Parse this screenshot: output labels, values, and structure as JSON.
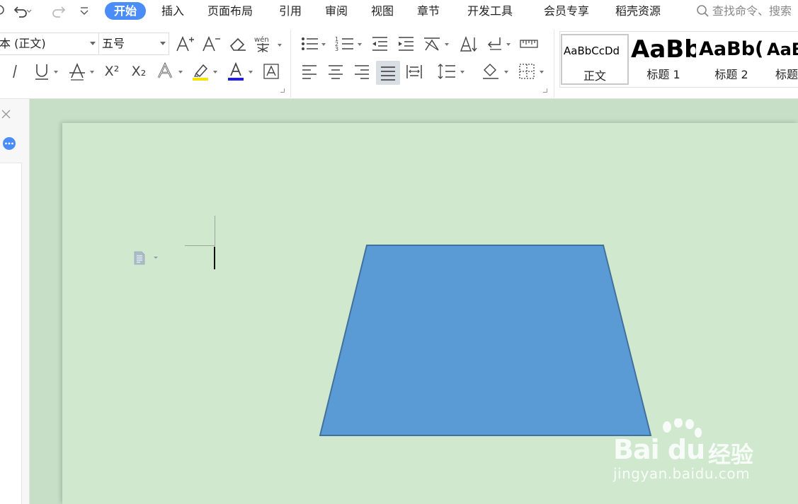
{
  "menubar": {
    "tabs": [
      {
        "label": "开始",
        "active": true
      },
      {
        "label": "插入"
      },
      {
        "label": "页面布局"
      },
      {
        "label": "引用"
      },
      {
        "label": "审阅"
      },
      {
        "label": "视图"
      },
      {
        "label": "章节"
      },
      {
        "label": "开发工具"
      },
      {
        "label": "会员专享"
      },
      {
        "label": "稻壳资源"
      }
    ],
    "search_label": "查找命令、搜索",
    "accent_color": "#4b8df8"
  },
  "ribbon": {
    "font_name": "本 (正文)",
    "font_size": "五号",
    "styles": [
      {
        "preview": "AaBbCcDd",
        "name": "正文"
      },
      {
        "preview": "AaBb",
        "name": "标题 1"
      },
      {
        "preview": "AaBb(",
        "name": "标题 2"
      },
      {
        "preview": "AaB",
        "name": "标题"
      }
    ],
    "superscript_label": "X²",
    "subscript_label": "X₂",
    "highlight_color": "#f5e400",
    "font_color": "#1f1fd6"
  },
  "document": {
    "shape": {
      "type": "trapezoid",
      "fill": "#5b9bd5",
      "stroke": "#41719c"
    },
    "page_color": "#cfe8ce"
  },
  "watermark": {
    "brand": "Bai du",
    "brand_cn": "经验",
    "url": "jingyan.baidu.com"
  }
}
